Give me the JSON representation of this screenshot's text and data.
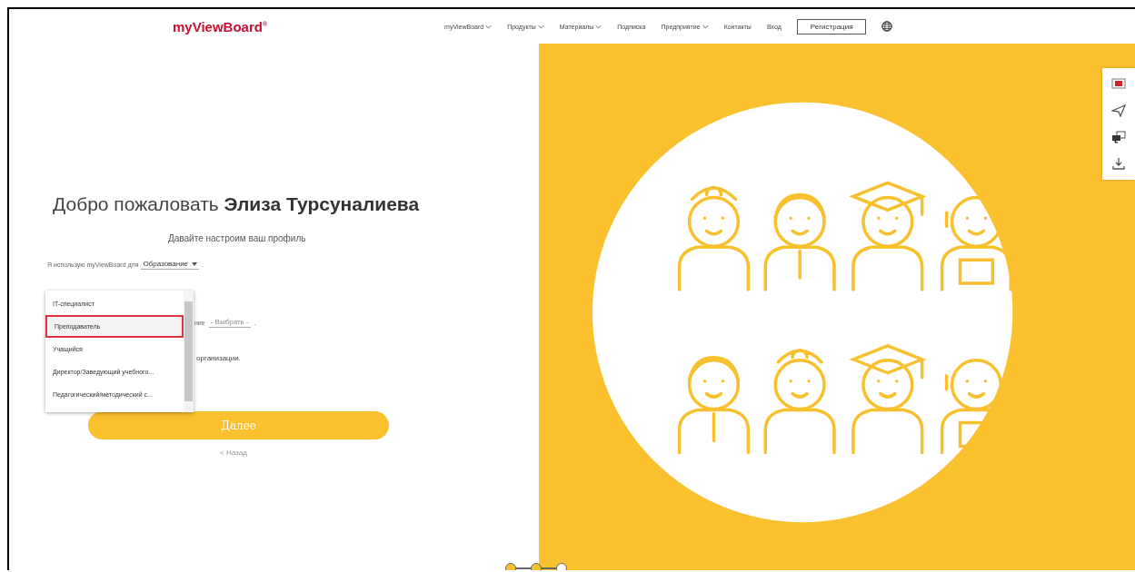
{
  "header": {
    "logo": "myViewBoard",
    "logo_mark": "®",
    "nav": [
      {
        "label": "myViewBoard",
        "dropdown": true
      },
      {
        "label": "Продукты",
        "dropdown": true
      },
      {
        "label": "Материалы",
        "dropdown": true
      },
      {
        "label": "Подписка",
        "dropdown": false
      },
      {
        "label": "Предприятие",
        "dropdown": true
      },
      {
        "label": "Контакты",
        "dropdown": false
      },
      {
        "label": "Вход",
        "dropdown": false
      }
    ],
    "register_button": "Регистрация"
  },
  "form": {
    "greeting": "Добро пожаловать",
    "user_name": "Элиза Турсуналиева",
    "subtitle": "Давайте настроим ваш профиль",
    "use_label": "Я использую myViewBoard для",
    "use_value": "Образование",
    "use_end": ".",
    "role_label_tail": "ние",
    "role_value": "- Выбрать -",
    "role_end": ".",
    "org_tail": "организации.",
    "role_options": [
      {
        "label": "IT-специалист",
        "selected": false
      },
      {
        "label": "Преподаватель",
        "selected": true
      },
      {
        "label": "Учащийся",
        "selected": false
      },
      {
        "label": "Директор/Заведующий учебного...",
        "selected": false
      },
      {
        "label": "Педагогический/методический с...",
        "selected": false
      }
    ],
    "next_button": "Далее",
    "back_link": "< Назад"
  },
  "steps": [
    {
      "done": true
    },
    {
      "done": true
    },
    {
      "done": false
    }
  ]
}
